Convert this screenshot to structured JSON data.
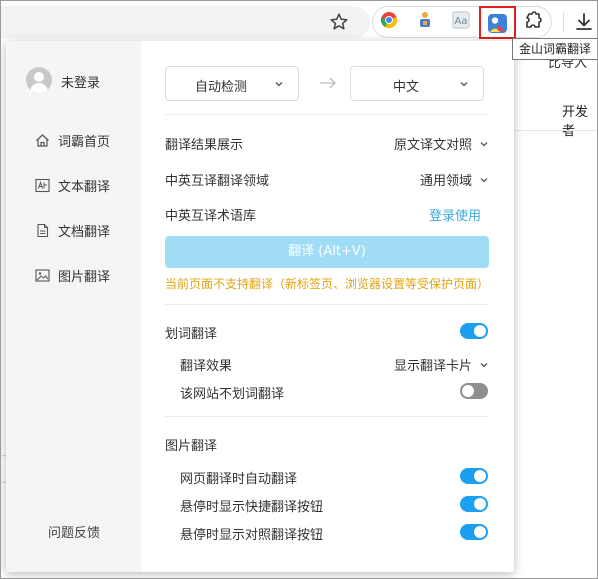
{
  "toolbar": {
    "star_icon": "star-icon",
    "extensions": [
      "chrome-extension-icon",
      "puzzle-figure-extension-icon",
      "font-extension-icon",
      "jinshan-ciba-extension-icon"
    ],
    "puzzle_icon": "puzzle-extensions-icon",
    "download_icon": "download-icon",
    "tooltip": "金山词霸翻译"
  },
  "background": {
    "partial_text_1": "比导入",
    "partial_text_2": "开发者"
  },
  "popup": {
    "sidebar": {
      "user_label": "未登录",
      "items": [
        {
          "label": "词霸首页",
          "icon": "home-icon"
        },
        {
          "label": "文本翻译",
          "icon": "text-translate-icon"
        },
        {
          "label": "文档翻译",
          "icon": "document-icon"
        },
        {
          "label": "图片翻译",
          "icon": "image-icon"
        }
      ],
      "feedback": "问题反馈"
    },
    "main": {
      "source_lang": "自动检测",
      "target_lang": "中文",
      "result_display_label": "翻译结果展示",
      "result_display_value": "原文译文对照",
      "domain_label": "中英互译翻译领域",
      "domain_value": "通用领域",
      "termbase_label": "中英互译术语库",
      "termbase_link": "登录使用",
      "translate_button": "翻译 (Alt+V)",
      "warning": "当前页面不支持翻译（新标签页、浏览器设置等受保护页面）",
      "word_translate": {
        "title": "划词翻译",
        "enabled": true,
        "effect_label": "翻译效果",
        "effect_value": "显示翻译卡片",
        "no_site_label": "该网站不划词翻译",
        "no_site_enabled": false
      },
      "image_translate": {
        "title": "图片翻译",
        "options": [
          {
            "label": "网页翻译时自动翻译",
            "enabled": true
          },
          {
            "label": "悬停时显示快捷翻译按钮",
            "enabled": true
          },
          {
            "label": "悬停时显示对照翻译按钮",
            "enabled": true
          }
        ]
      }
    }
  },
  "colors": {
    "accent": "#1d9ff0",
    "button_disabled": "#a0dcf6",
    "link": "#3fa9e0",
    "warning": "#e3a416",
    "highlight_border": "#e0201c"
  }
}
